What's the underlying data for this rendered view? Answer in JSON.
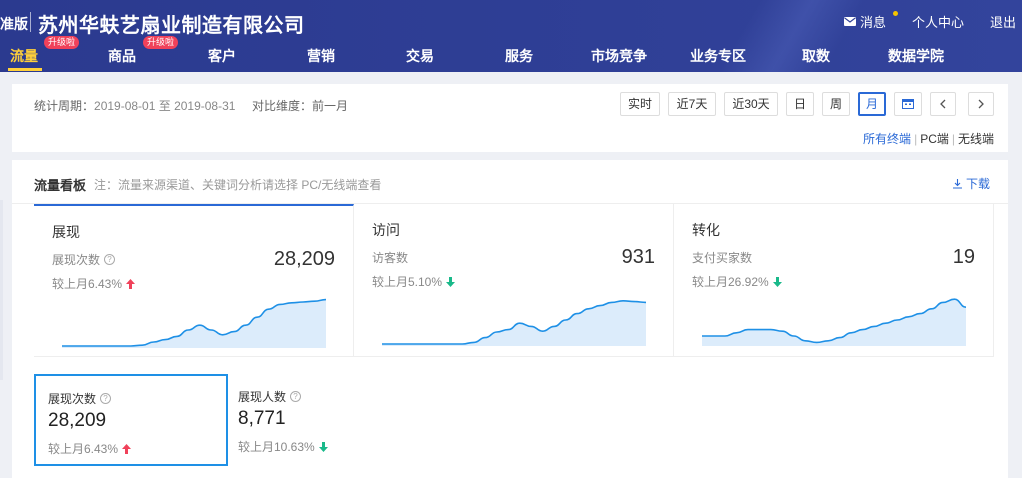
{
  "header": {
    "edition": "准版",
    "shop_name": "苏州华蚨艺扇业制造有限公司",
    "links": {
      "messages": "消息",
      "user_center": "个人中心",
      "logout": "退出"
    },
    "nav": [
      {
        "label": "流量",
        "badge": "升级啦"
      },
      {
        "label": "商品",
        "badge": "升级啦"
      },
      {
        "label": "客户"
      },
      {
        "label": "营销"
      },
      {
        "label": "交易"
      },
      {
        "label": "服务"
      },
      {
        "label": "市场竞争"
      },
      {
        "label": "业务专区"
      },
      {
        "label": "取数"
      },
      {
        "label": "数据学院"
      }
    ],
    "active_nav": "流量",
    "accent_color": "#ffd03a",
    "header_color": "#2f3f96"
  },
  "filter": {
    "period_label": "统计周期：",
    "period_value": "2019-08-01 至 2019-08-31",
    "compare_label": "对比维度：",
    "compare_value": "前一月",
    "ranges": [
      "实时",
      "近7天",
      "近30天",
      "日",
      "周",
      "月"
    ],
    "active_range": "月",
    "terminals": {
      "all": "所有终端",
      "pc": "PC端",
      "mobile": "无线端",
      "active": "所有终端"
    }
  },
  "board": {
    "title": "流量看板",
    "note": "注：流量来源渠道、关键词分析请选择 PC/无线端查看",
    "download": "下载",
    "cards": [
      {
        "title": "展现",
        "metric": "展现次数",
        "value": "28,209",
        "change": "较上月6.43%",
        "direction": "up",
        "trend": [
          0,
          0,
          0,
          0,
          0,
          0,
          0,
          1,
          5,
          8,
          12,
          20,
          26,
          20,
          14,
          18,
          26,
          36,
          46,
          52,
          54,
          55,
          56,
          58
        ]
      },
      {
        "title": "访问",
        "metric": "访客数",
        "value": "931",
        "change": "较上月5.10%",
        "direction": "down",
        "trend": [
          0,
          0,
          0,
          0,
          0,
          0,
          0,
          0,
          2,
          8,
          15,
          18,
          26,
          22,
          16,
          22,
          30,
          38,
          44,
          48,
          52,
          54,
          53,
          52
        ]
      },
      {
        "title": "转化",
        "metric": "支付买家数",
        "value": "19",
        "change": "较上月26.92%",
        "direction": "down",
        "trend": [
          10,
          10,
          10,
          14,
          18,
          18,
          18,
          16,
          10,
          4,
          2,
          4,
          8,
          14,
          18,
          22,
          26,
          30,
          34,
          38,
          44,
          52,
          56,
          46
        ]
      }
    ],
    "stats": [
      {
        "label": "展现次数",
        "value": "28,209",
        "change": "较上月6.43%",
        "direction": "up"
      },
      {
        "label": "展现人数",
        "value": "8,771",
        "change": "较上月10.63%",
        "direction": "down"
      }
    ]
  },
  "colors": {
    "up": "#f0415a",
    "down": "#19b98a",
    "link": "#2a69d6",
    "line": "#1e90e6",
    "area": "#dcecfb"
  }
}
